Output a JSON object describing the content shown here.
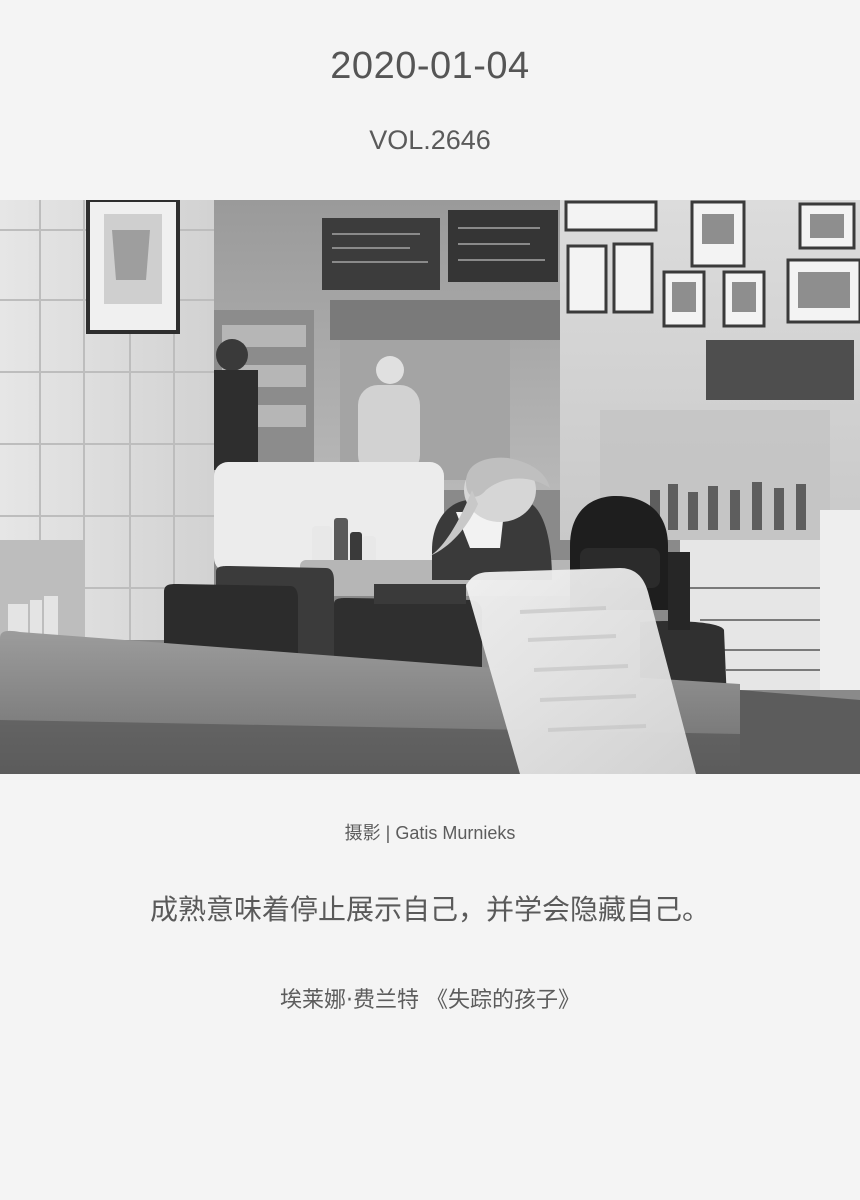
{
  "header": {
    "date": "2020-01-04",
    "volume": "VOL.2646"
  },
  "photo": {
    "icon": "photo-diner-girl",
    "tone": "grayscale"
  },
  "caption": {
    "credit": "摄影 | Gatis Murnieks",
    "quote": "成熟意味着停止展示自己，并学会隐藏自己。",
    "source": "埃莱娜·费兰特 《失踪的孩子》"
  },
  "colors": {
    "background": "#f4f4f4",
    "text": "#555555"
  }
}
